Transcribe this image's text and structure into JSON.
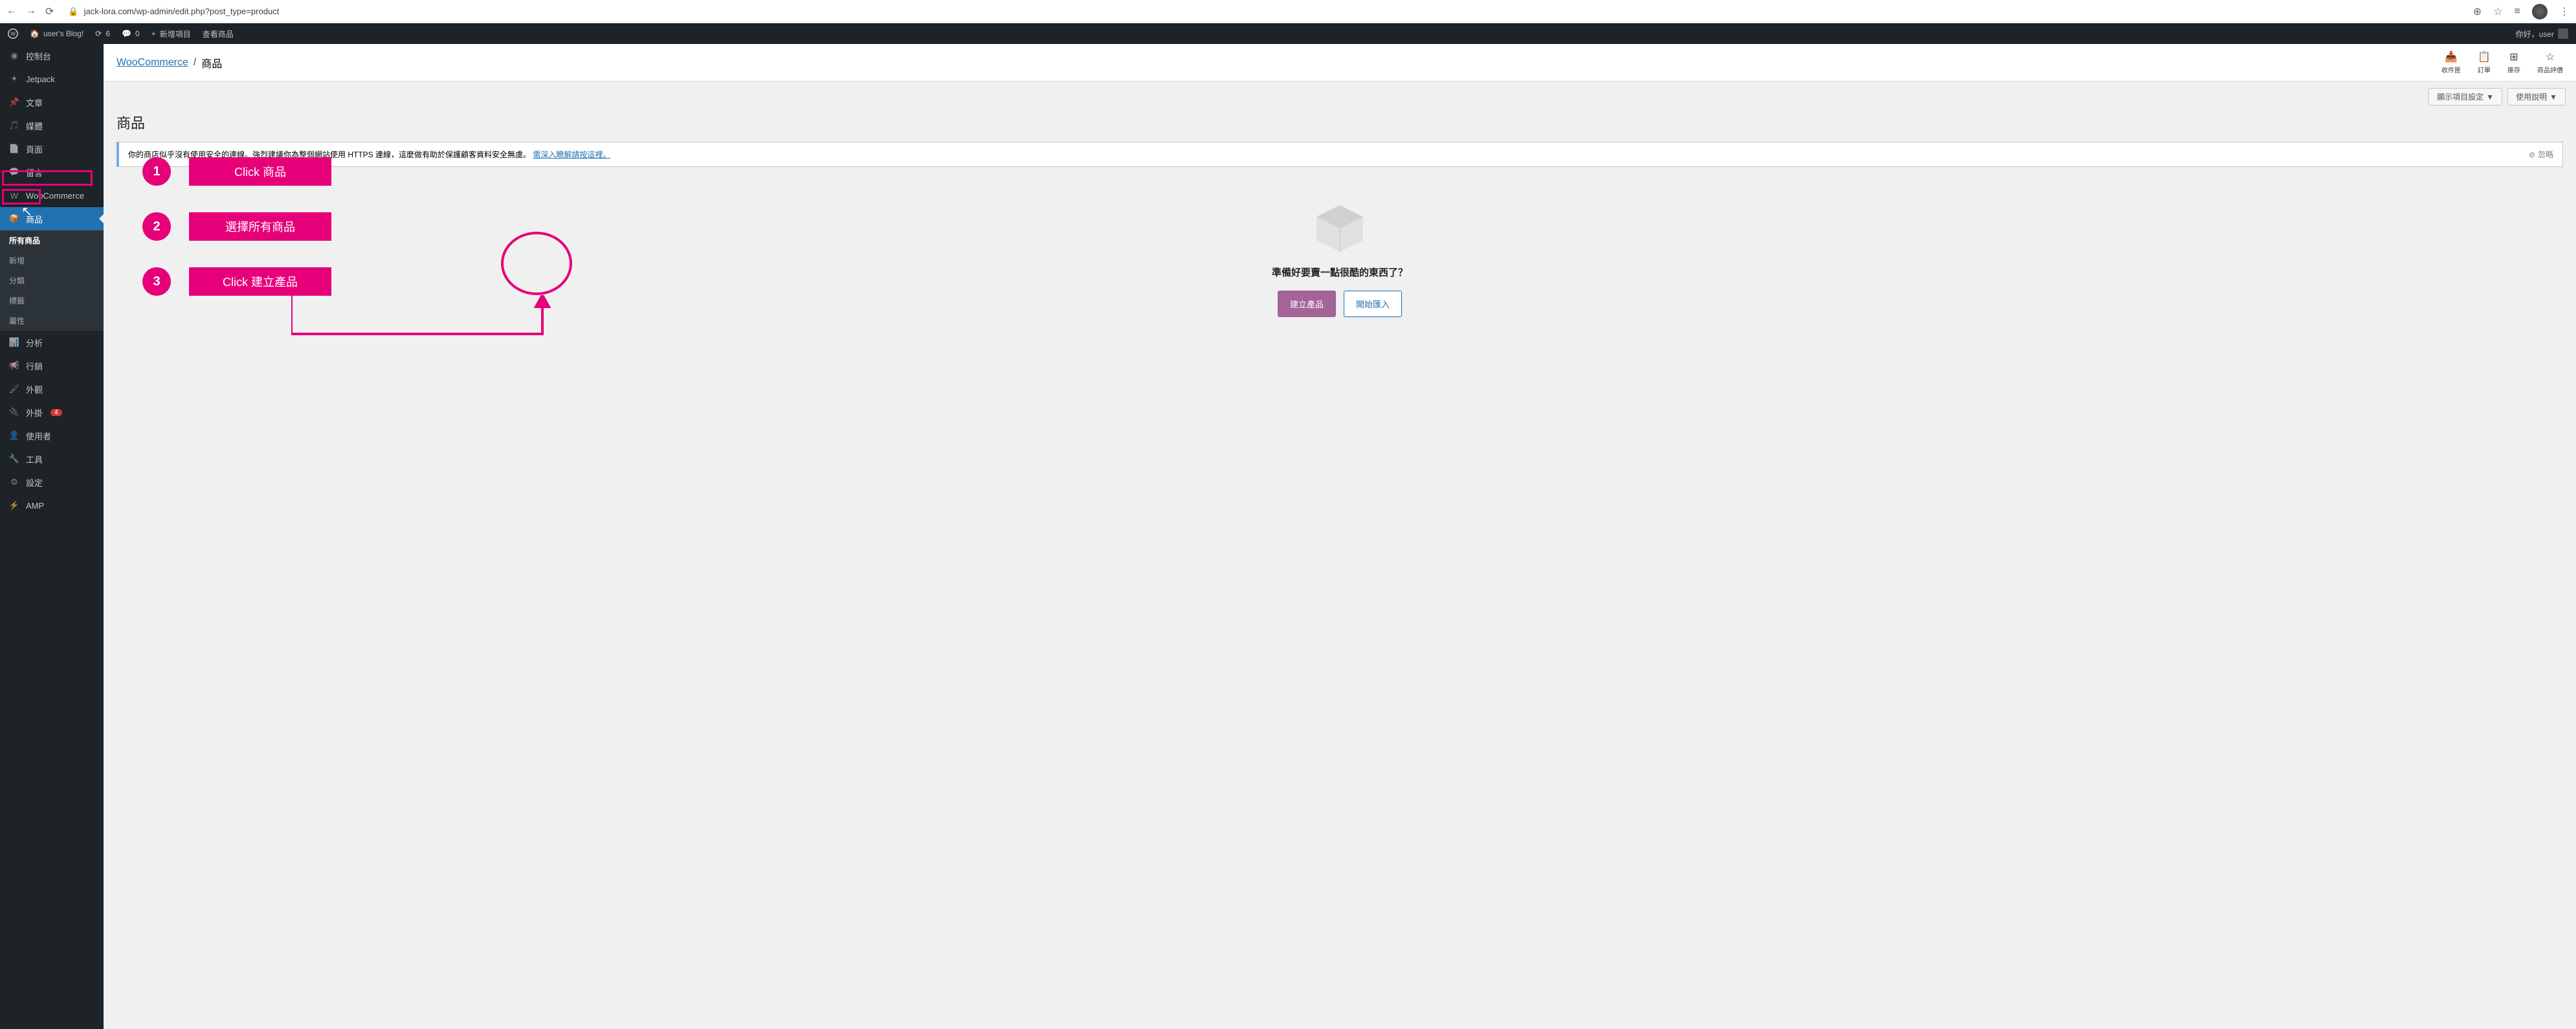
{
  "browser": {
    "url": "jack-lora.com/wp-admin/edit.php?post_type=product"
  },
  "adminbar": {
    "site_name": "user's Blog!",
    "updates": "6",
    "comments": "0",
    "new": "新增項目",
    "view": "查看商品",
    "howdy": "你好，user"
  },
  "sidebar": {
    "items": [
      {
        "label": "控制台",
        "icon": "dashboard"
      },
      {
        "label": "Jetpack",
        "icon": "jetpack"
      },
      {
        "label": "文章",
        "icon": "pin"
      },
      {
        "label": "媒體",
        "icon": "media"
      },
      {
        "label": "頁面",
        "icon": "page"
      },
      {
        "label": "留言",
        "icon": "comment"
      },
      {
        "label": "WooCommerce",
        "icon": "woo"
      },
      {
        "label": "商品",
        "icon": "product",
        "active": true
      },
      {
        "label": "分析",
        "icon": "analytics"
      },
      {
        "label": "行銷",
        "icon": "marketing"
      },
      {
        "label": "外觀",
        "icon": "appearance"
      },
      {
        "label": "外掛",
        "icon": "plugins",
        "badge": "4"
      },
      {
        "label": "使用者",
        "icon": "users"
      },
      {
        "label": "工具",
        "icon": "tools"
      },
      {
        "label": "設定",
        "icon": "settings"
      },
      {
        "label": "AMP",
        "icon": "amp"
      }
    ],
    "submenu": [
      "所有商品",
      "新增",
      "分類",
      "標籤",
      "屬性"
    ]
  },
  "breadcrumb": {
    "root": "WooCommerce",
    "current": "商品"
  },
  "top_icons": [
    {
      "label": "收件匣",
      "icon": "📥"
    },
    {
      "label": "訂單",
      "icon": "📋"
    },
    {
      "label": "庫存",
      "icon": "⊞"
    },
    {
      "label": "商品評價",
      "icon": "☆"
    }
  ],
  "tabs": {
    "screen_options": "顯示項目設定",
    "help": "使用說明"
  },
  "page_title": "商品",
  "notice": {
    "text_before": "你的商店似乎沒有使用安全的連線。強烈建議你為整個網站使用 HTTPS 連線，這麼做有助於保護顧客資料安全無虞。",
    "link": "需深入瞭解請按這裡。",
    "dismiss": "忽略"
  },
  "empty": {
    "heading": "準備好要賣一點很酷的東西了？",
    "create_btn": "建立產品",
    "import_btn": "開始匯入"
  },
  "steps": [
    {
      "num": "1",
      "label": "Click 商品"
    },
    {
      "num": "2",
      "label": "選擇所有商品"
    },
    {
      "num": "3",
      "label": "Click 建立產品"
    }
  ]
}
